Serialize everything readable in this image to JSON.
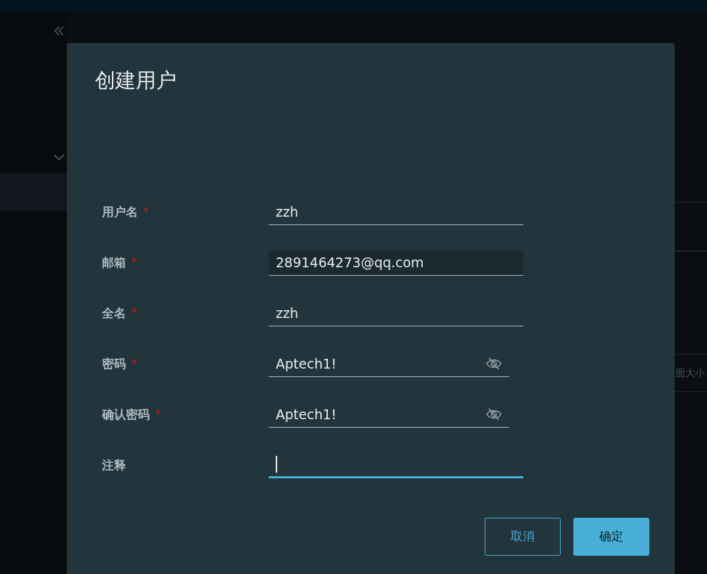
{
  "background": {
    "table_text": "面大小"
  },
  "dialog": {
    "title": "创建用户",
    "fields": [
      {
        "label": "用户名",
        "required_mark": "*",
        "kind": "text",
        "value": "zzh",
        "autofilled": false,
        "focused": false
      },
      {
        "label": "邮箱",
        "required_mark": "*",
        "kind": "text",
        "value": "2891464273@qq.com",
        "autofilled": true,
        "focused": false
      },
      {
        "label": "全名",
        "required_mark": "*",
        "kind": "text",
        "value": "zzh",
        "autofilled": false,
        "focused": false
      },
      {
        "label": "密码",
        "required_mark": "*",
        "kind": "password",
        "value": "Aptech1!",
        "autofilled": false,
        "focused": false
      },
      {
        "label": "确认密码",
        "required_mark": "*",
        "kind": "password",
        "value": "Aptech1!",
        "autofilled": false,
        "focused": false
      },
      {
        "label": "注释",
        "kind": "text",
        "autofilled": false,
        "focused": true
      }
    ],
    "buttons": [
      {
        "label": "取消",
        "kind": "outline"
      },
      {
        "label": "确定",
        "kind": "primary"
      }
    ]
  }
}
